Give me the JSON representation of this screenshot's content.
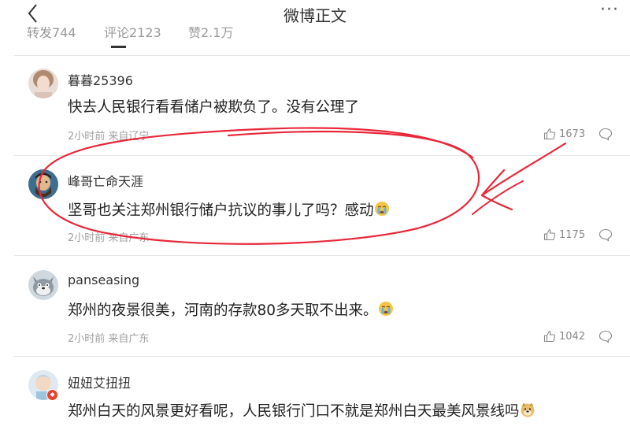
{
  "header": {
    "title": "微博正文"
  },
  "tabs": [
    {
      "label": "转发744"
    },
    {
      "label": "评论2123"
    },
    {
      "label": "赞2.1万"
    }
  ],
  "comments": [
    {
      "user": "暮暮25396",
      "text": "快去人民银行看看储户被欺负了。没有公理了",
      "meta": "2小时前 来自辽宁",
      "likes": "1673",
      "emoji": ""
    },
    {
      "user": "峰哥亡命天涯",
      "text": "坚哥也关注郑州银行储户抗议的事儿了吗？感动",
      "meta": "2小时前 来自广东",
      "likes": "1175",
      "emoji": "crying-face"
    },
    {
      "user": "panseasing",
      "text": "郑州的夜景很美，河南的存款80多天取不出来。",
      "meta": "2小时前 来自广东",
      "likes": "1042",
      "emoji": "crying-face"
    },
    {
      "user": "妞妞艾扭扭",
      "text": "郑州白天的风景更好看呢，人民银行门口不就是郑州白天最美风景线吗",
      "meta": "",
      "likes": "",
      "emoji": "doge-face"
    }
  ],
  "colors": {
    "annotation": "#e8283a",
    "meta_text": "#a0a0a0"
  }
}
